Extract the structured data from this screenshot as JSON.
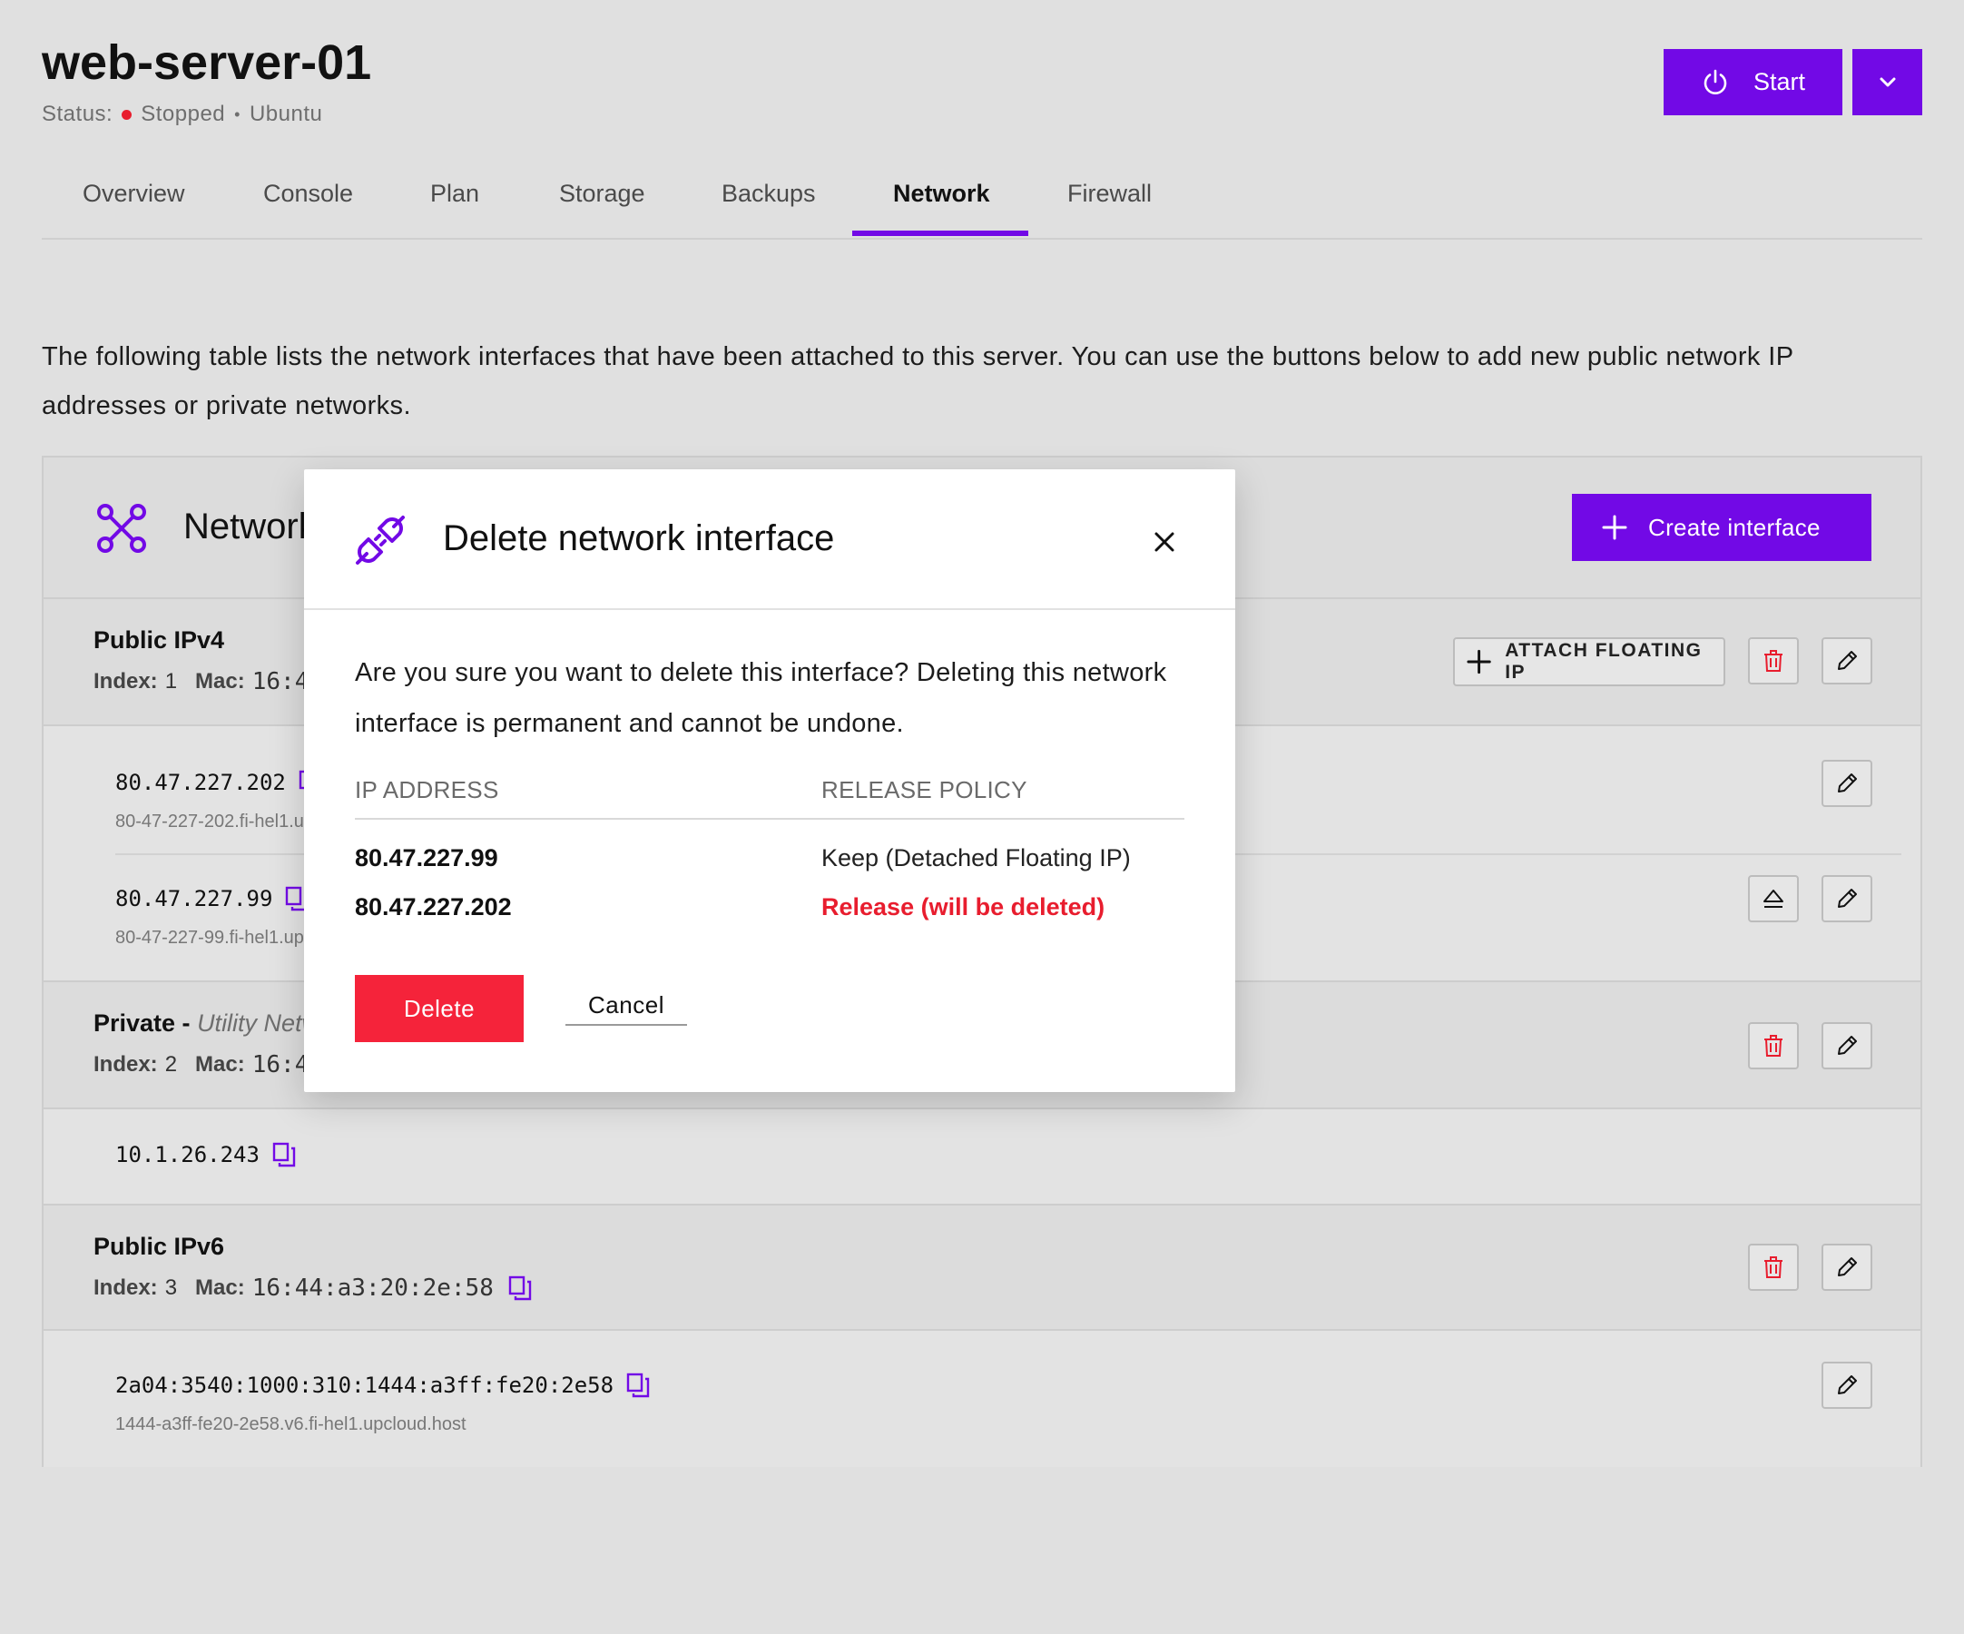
{
  "header": {
    "title": "web-server-01",
    "status_label": "Status:",
    "status_value": "Stopped",
    "os": "Ubuntu",
    "start_label": "Start",
    "status_color": "#e81d2e",
    "accent_color": "#7209e6"
  },
  "tabs": [
    {
      "label": "Overview"
    },
    {
      "label": "Console"
    },
    {
      "label": "Plan"
    },
    {
      "label": "Storage"
    },
    {
      "label": "Backups"
    },
    {
      "label": "Network",
      "active": true
    },
    {
      "label": "Firewall"
    }
  ],
  "intro": "The following table lists the network interfaces that have been attached to this server. You can use the buttons below to add new public network IP addresses or private networks.",
  "panel": {
    "title": "Network",
    "create_label": "Create interface",
    "attach_label": "ATTACH FLOATING IP",
    "interfaces": [
      {
        "name": "Public IPv4",
        "index_label": "Index:",
        "index": "1",
        "mac_label": "Mac:",
        "mac": "16:4",
        "addresses": [
          {
            "ip": "80.47.227.202",
            "host": "80-47-227-202.fi-hel1.u"
          },
          {
            "ip": "80.47.227.99",
            "host": "80-47-227-99.fi-hel1.up"
          }
        ]
      },
      {
        "name": "Private - ",
        "network": "Utility Netw",
        "index_label": "Index:",
        "index": "2",
        "mac_label": "Mac:",
        "mac": "16:4",
        "addresses": [
          {
            "ip": "10.1.26.243"
          }
        ]
      },
      {
        "name": "Public IPv6",
        "index_label": "Index:",
        "index": "3",
        "mac_label": "Mac:",
        "mac": "16:44:a3:20:2e:58",
        "addresses": [
          {
            "ip": "2a04:3540:1000:310:1444:a3ff:fe20:2e58",
            "host": "1444-a3ff-fe20-2e58.v6.fi-hel1.upcloud.host"
          }
        ]
      }
    ]
  },
  "modal": {
    "title": "Delete network interface",
    "body": "Are you sure you want to delete this interface? Deleting this network interface is permanent and cannot be undone.",
    "col_ip": "IP ADDRESS",
    "col_policy": "RELEASE POLICY",
    "rows": [
      {
        "ip": "80.47.227.99",
        "policy": "Keep (Detached Floating IP)"
      },
      {
        "ip": "80.47.227.202",
        "policy": "Release (will be deleted)"
      }
    ],
    "delete_label": "Delete",
    "cancel_label": "Cancel",
    "danger_color": "#f5233a"
  },
  "icons": {
    "start": "power-icon",
    "more": "chevron-down-icon",
    "panel": "network-nodes-icon",
    "modal": "unplug-icon",
    "close": "close-icon",
    "copy": "copy-icon",
    "delete": "trash-icon",
    "edit": "pencil-icon",
    "detach": "eject-icon",
    "add": "plus-icon"
  }
}
